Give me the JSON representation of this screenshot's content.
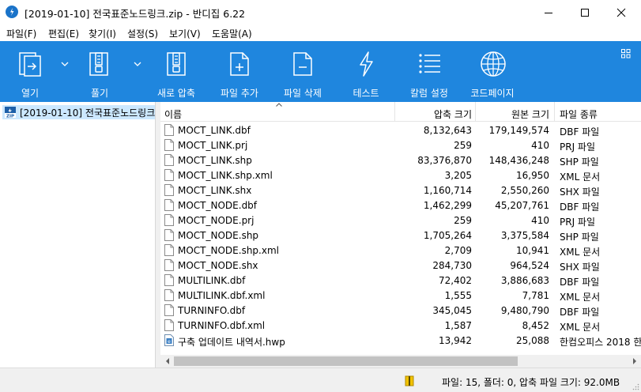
{
  "window": {
    "title": "[2019-01-10] 전국표준노드링크.zip - 반디집 6.22"
  },
  "menu": [
    {
      "label": "파일(F)"
    },
    {
      "label": "편집(E)"
    },
    {
      "label": "찾기(I)"
    },
    {
      "label": "설정(S)"
    },
    {
      "label": "보기(V)"
    },
    {
      "label": "도움말(A)"
    }
  ],
  "toolbar": {
    "open": "열기",
    "extract": "풀기",
    "new_archive": "새로 압축",
    "add_file": "파일 추가",
    "delete_file": "파일 삭제",
    "test": "테스트",
    "column_settings": "칼럼 설정",
    "codepage": "코드페이지"
  },
  "tree": {
    "item": "[2019-01-10] 전국표준노드링크"
  },
  "columns": {
    "name": "이름",
    "compressed": "압축 크기",
    "original": "원본 크기",
    "type": "파일 종류"
  },
  "files": [
    {
      "name": "MOCT_LINK.dbf",
      "compressed": "8,132,643",
      "original": "179,149,574",
      "type": "DBF 파일"
    },
    {
      "name": "MOCT_LINK.prj",
      "compressed": "259",
      "original": "410",
      "type": "PRJ 파일"
    },
    {
      "name": "MOCT_LINK.shp",
      "compressed": "83,376,870",
      "original": "148,436,248",
      "type": "SHP 파일"
    },
    {
      "name": "MOCT_LINK.shp.xml",
      "compressed": "3,205",
      "original": "16,950",
      "type": "XML 문서"
    },
    {
      "name": "MOCT_LINK.shx",
      "compressed": "1,160,714",
      "original": "2,550,260",
      "type": "SHX 파일"
    },
    {
      "name": "MOCT_NODE.dbf",
      "compressed": "1,462,299",
      "original": "45,207,761",
      "type": "DBF 파일"
    },
    {
      "name": "MOCT_NODE.prj",
      "compressed": "259",
      "original": "410",
      "type": "PRJ 파일"
    },
    {
      "name": "MOCT_NODE.shp",
      "compressed": "1,705,264",
      "original": "3,375,584",
      "type": "SHP 파일"
    },
    {
      "name": "MOCT_NODE.shp.xml",
      "compressed": "2,709",
      "original": "10,941",
      "type": "XML 문서"
    },
    {
      "name": "MOCT_NODE.shx",
      "compressed": "284,730",
      "original": "964,524",
      "type": "SHX 파일"
    },
    {
      "name": "MULTILINK.dbf",
      "compressed": "72,402",
      "original": "3,886,683",
      "type": "DBF 파일"
    },
    {
      "name": "MULTILINK.dbf.xml",
      "compressed": "1,555",
      "original": "7,781",
      "type": "XML 문서"
    },
    {
      "name": "TURNINFO.dbf",
      "compressed": "345,045",
      "original": "9,480,790",
      "type": "DBF 파일"
    },
    {
      "name": "TURNINFO.dbf.xml",
      "compressed": "1,587",
      "original": "8,452",
      "type": "XML 문서"
    },
    {
      "name": "구축 업데이트 내역서.hwp",
      "compressed": "13,942",
      "original": "25,088",
      "type": "한컴오피스 2018 한"
    }
  ],
  "status": {
    "text": "파일: 15, 폴더: 0, 압축 파일 크기: 92.0MB"
  },
  "colors": {
    "toolbar_bg": "#1f86de",
    "selection": "#cce8ff"
  }
}
